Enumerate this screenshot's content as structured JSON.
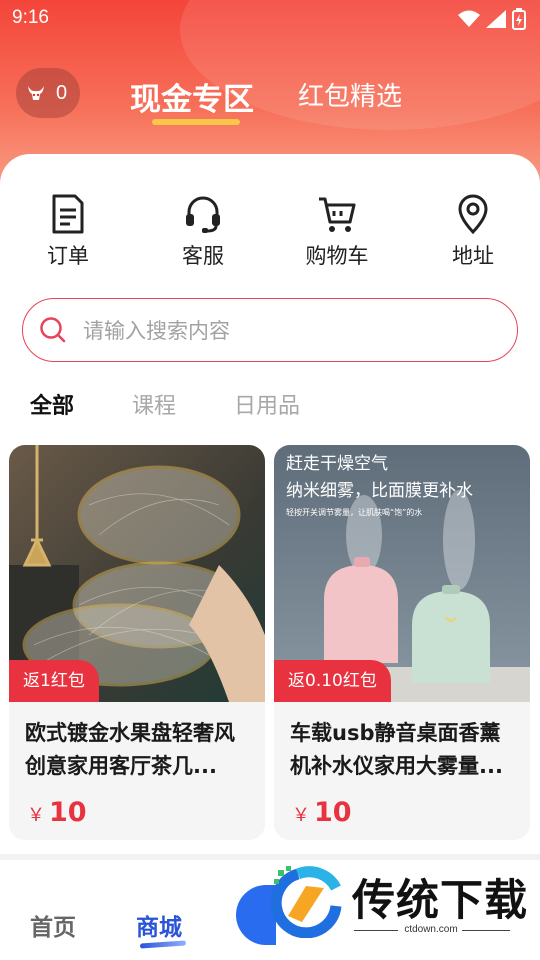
{
  "status": {
    "time": "9:16"
  },
  "header": {
    "coin_count": "0",
    "tab_active": "现金专区",
    "tab_inactive": "红包精选"
  },
  "quick_actions": [
    {
      "label": "订单",
      "icon": "order-document-icon"
    },
    {
      "label": "客服",
      "icon": "headset-icon"
    },
    {
      "label": "购物车",
      "icon": "shopping-cart-icon"
    },
    {
      "label": "地址",
      "icon": "location-pin-icon"
    }
  ],
  "search": {
    "placeholder": "请输入搜索内容"
  },
  "categories": [
    "全部",
    "课程",
    "日用品"
  ],
  "products": [
    {
      "badge": "返1红包",
      "title": "欧式镀金水果盘轻奢风创意家用客厅茶几...",
      "currency": "￥",
      "price": "10"
    },
    {
      "badge": "返0.10红包",
      "title": "车载usb静音桌面香薰机补水仪家用大雾量...",
      "currency": "￥",
      "price": "10",
      "image_text_1": "赶走干燥空气",
      "image_text_2": "纳米细雾，比面膜更补水",
      "image_text_3": "轻按开关调节雾量，让肌肤喝“饱”的水"
    }
  ],
  "bottom_nav": {
    "home": "首页",
    "shop": "商城"
  },
  "watermark": {
    "text": "传统下载",
    "url": "ctdown.com"
  },
  "colors": {
    "accent": "#e8323f",
    "nav_active": "#2a54d8"
  }
}
